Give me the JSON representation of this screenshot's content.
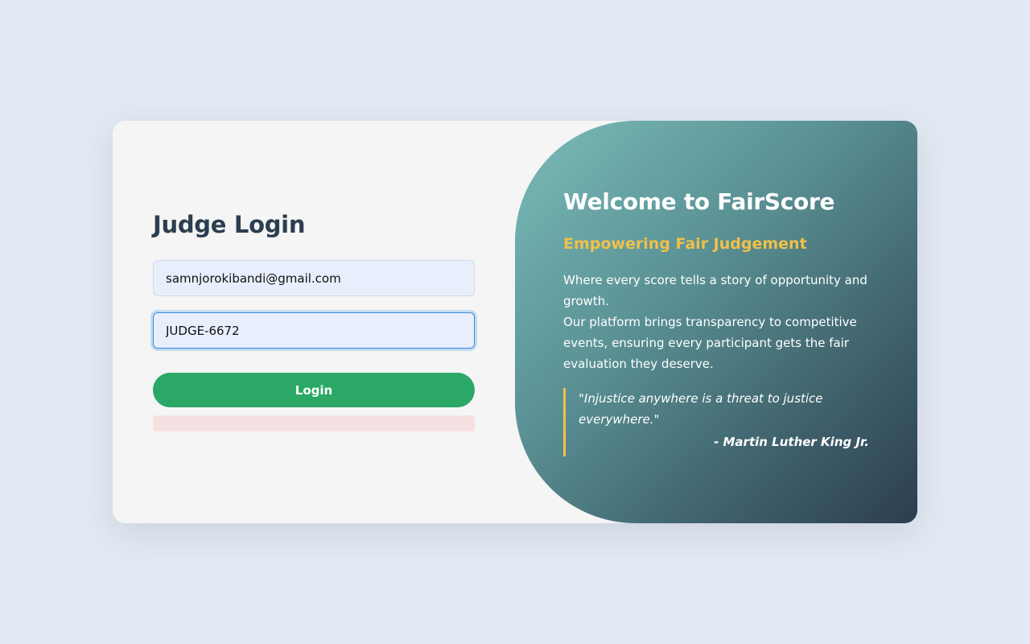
{
  "login": {
    "title": "Judge Login",
    "email_value": "samnjorokibandi@gmail.com",
    "code_value": "JUDGE-6672",
    "button_label": "Login",
    "error_message": ""
  },
  "welcome": {
    "title": "Welcome to FairScore",
    "tagline": "Empowering Fair Judgement",
    "description_line1": "Where every score tells a story of opportunity and growth.",
    "description_line2": "Our platform brings transparency to competitive events, ensuring every participant gets the fair evaluation they deserve.",
    "quote_text": "\"Injustice anywhere is a threat to justice everywhere.\"",
    "quote_author": "- Martin Luther King Jr."
  },
  "colors": {
    "background": "#e2e9f2",
    "title_text": "#2c3e50",
    "button": "#2ba866",
    "accent_gold": "#f1c04a",
    "error_bg": "#f5e0e2",
    "gradient_start": "#7bbcba",
    "gradient_end": "#2c3e50"
  }
}
